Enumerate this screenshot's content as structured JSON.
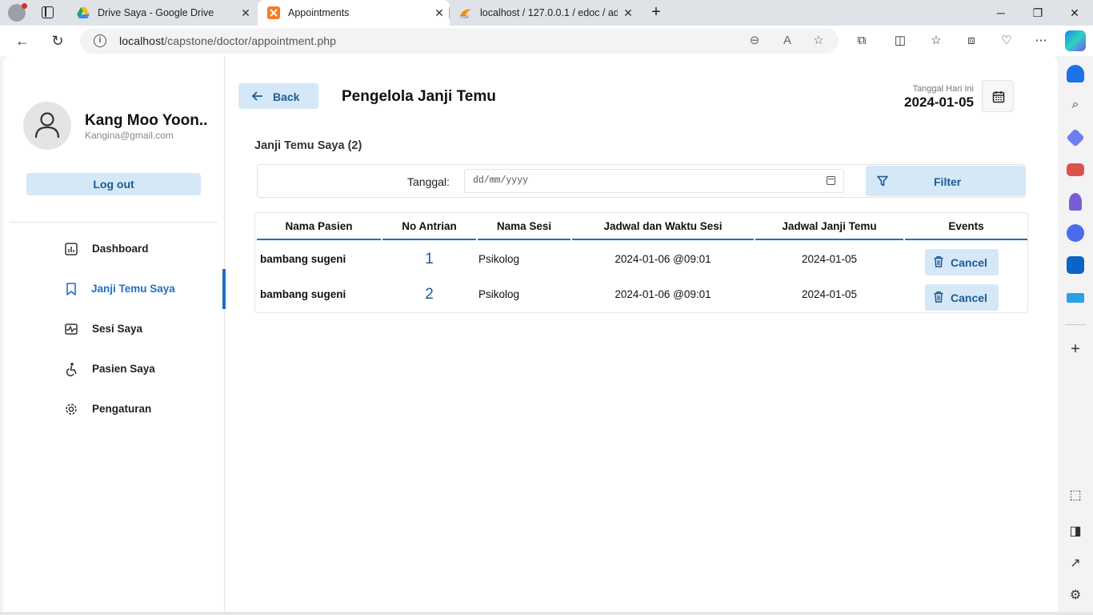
{
  "browser": {
    "tabs": [
      {
        "title": "Drive Saya - Google Drive",
        "active": false
      },
      {
        "title": "Appointments",
        "active": true
      },
      {
        "title": "localhost / 127.0.0.1 / edoc / adm",
        "active": false
      }
    ],
    "url_host": "localhost",
    "url_path": "/capstone/doctor/appointment.php"
  },
  "profile": {
    "name": "Kang Moo Yoon..",
    "email": "Kangina@gmail.com",
    "logout_label": "Log out"
  },
  "menu": {
    "items": [
      {
        "label": "Dashboard",
        "icon": "dashboard-icon"
      },
      {
        "label": "Janji Temu Saya",
        "icon": "bookmark-icon",
        "active": true
      },
      {
        "label": "Sesi Saya",
        "icon": "session-icon"
      },
      {
        "label": "Pasien Saya",
        "icon": "patient-icon"
      },
      {
        "label": "Pengaturan",
        "icon": "gear-icon"
      }
    ]
  },
  "header": {
    "back_label": "Back",
    "title": "Pengelola Janji Temu",
    "date_label": "Tanggal Hari Ini",
    "date_value": "2024-01-05"
  },
  "section": {
    "title": "Janji Temu Saya (2)"
  },
  "filter": {
    "label": "Tanggal:",
    "placeholder": "dd/mm/yyyy",
    "button_label": "Filter"
  },
  "table": {
    "columns": [
      "Nama Pasien",
      "No Antrian",
      "Nama Sesi",
      "Jadwal dan Waktu Sesi",
      "Jadwal Janji Temu",
      "Events"
    ],
    "rows": [
      {
        "patient": "bambang sugeni",
        "queue": "1",
        "session": "Psikolog",
        "session_time": "2024-01-06 @09:01",
        "appointment_date": "2024-01-05",
        "action": "Cancel"
      },
      {
        "patient": "bambang sugeni",
        "queue": "2",
        "session": "Psikolog",
        "session_time": "2024-01-06 @09:01",
        "appointment_date": "2024-01-05",
        "action": "Cancel"
      }
    ]
  },
  "colors": {
    "accent": "#1f6fc5",
    "button_bg": "#d5e8f8",
    "button_text": "#1f5a96"
  }
}
